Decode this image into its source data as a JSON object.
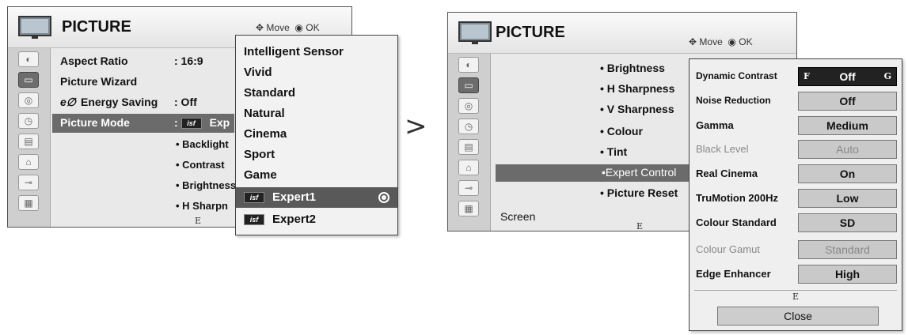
{
  "left_screen": {
    "title": "PICTURE",
    "hint_move": "Move",
    "hint_ok": "OK",
    "rows": [
      {
        "label": "Aspect Ratio",
        "value": ": 16:9"
      },
      {
        "label": "Picture Wizard",
        "value": ""
      },
      {
        "label": "Energy Saving",
        "value": ": Off"
      },
      {
        "label": "Picture Mode",
        "value": ": ",
        "value_suffix": "Exp"
      }
    ],
    "sub_rows": [
      "• Backlight",
      "• Contrast",
      "• Brightness",
      "• H Sharpn"
    ],
    "footer_marker": "E",
    "isf_badge": "isf",
    "dropdown": {
      "items": [
        "Intelligent Sensor",
        "Vivid",
        "Standard",
        "Natural",
        "Cinema",
        "Sport",
        "Game",
        "Expert1",
        "Expert2"
      ],
      "selected_index": 7
    }
  },
  "arrow": ">",
  "right_screen": {
    "title": "PICTURE",
    "hint_move": "Move",
    "hint_ok": "OK",
    "menu": [
      "• Brightness",
      "• H Sharpness",
      "• V Sharpness",
      "• Colour",
      "• Tint",
      "•Expert Control",
      "• Picture Reset"
    ],
    "selected_menu_index": 5,
    "screen_label": "Screen",
    "footer_marker": "E",
    "expert_panel": {
      "items": [
        {
          "label": "Dynamic Contrast",
          "value": "Off",
          "left_glyph": "F",
          "right_glyph": "G",
          "active": true,
          "dim": false
        },
        {
          "label": "Noise Reduction",
          "value": "Off",
          "dim": false
        },
        {
          "label": "Gamma",
          "value": "Medium",
          "dim": false
        },
        {
          "label": "Black Level",
          "value": "Auto",
          "dim": true
        },
        {
          "label": "Real Cinema",
          "value": "On",
          "dim": false
        },
        {
          "label": "TruMotion 200Hz",
          "value": "Low",
          "dim": false
        },
        {
          "label": "Colour Standard",
          "value": "SD",
          "dim": false
        },
        {
          "label": "Colour Gamut",
          "value": "Standard",
          "dim": true
        },
        {
          "label": "Edge Enhancer",
          "value": "High",
          "dim": false
        }
      ],
      "footer_marker": "E",
      "close_label": "Close"
    }
  }
}
